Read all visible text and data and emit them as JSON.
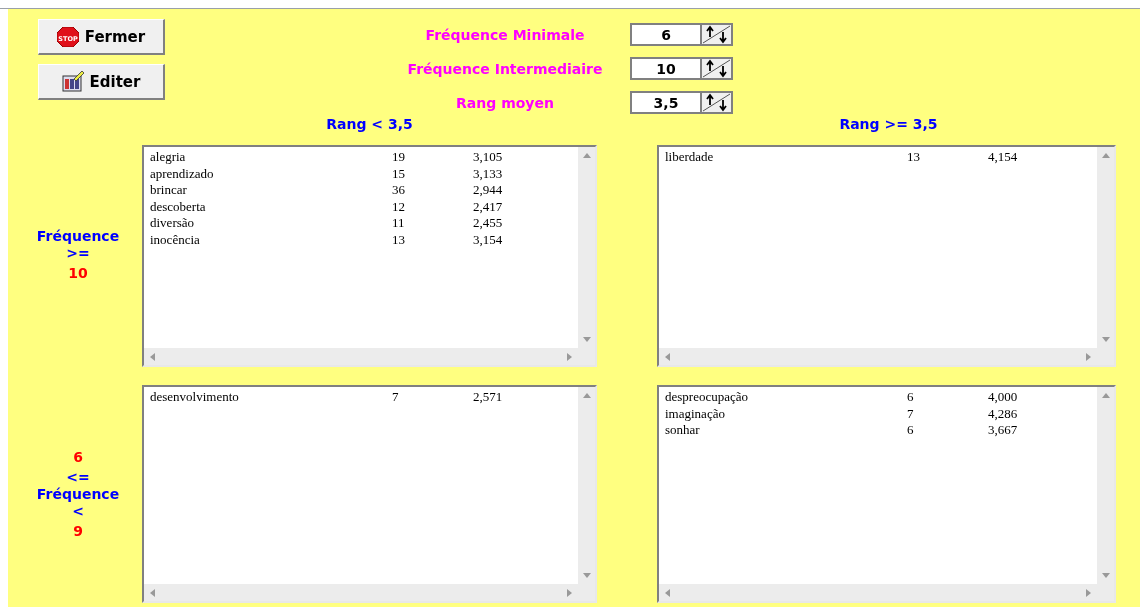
{
  "buttons": [
    {
      "kind": "stop",
      "label": "Fermer",
      "icon_label": "STOP"
    },
    {
      "kind": "edit",
      "label": "Editer"
    }
  ],
  "spinners": [
    {
      "label": "Fréquence Minimale",
      "value": "6"
    },
    {
      "label": "Fréquence Intermediaire",
      "value": "10"
    },
    {
      "label": "Rang moyen",
      "value": "3,5"
    }
  ],
  "column_headers": [
    "Rang < 3,5",
    "Rang >= 3,5"
  ],
  "row_groups": [
    {
      "label_lines": [
        {
          "kind": "text",
          "text": "Fréquence"
        },
        {
          "kind": "text",
          "text": ">="
        },
        {
          "kind": "value",
          "text": "10"
        }
      ],
      "lists": [
        {
          "rows": [
            [
              "alegria",
              "19",
              "3,105"
            ],
            [
              "aprendizado",
              "15",
              "3,133"
            ],
            [
              "brincar",
              "36",
              "2,944"
            ],
            [
              "descoberta",
              "12",
              "2,417"
            ],
            [
              "diversão",
              "11",
              "2,455"
            ],
            [
              "inocência",
              "13",
              "3,154"
            ]
          ]
        },
        {
          "rows": [
            [
              "liberdade",
              "13",
              "4,154"
            ]
          ]
        }
      ]
    },
    {
      "label_lines": [
        {
          "kind": "value",
          "text": "6"
        },
        {
          "kind": "text",
          "text": "<="
        },
        {
          "kind": "text",
          "text": "Fréquence"
        },
        {
          "kind": "text",
          "text": "<"
        },
        {
          "kind": "value",
          "text": "9"
        }
      ],
      "lists": [
        {
          "rows": [
            [
              "desenvolvimento",
              "7",
              "2,571"
            ]
          ]
        },
        {
          "rows": [
            [
              "despreocupação",
              "6",
              "4,000"
            ],
            [
              "imaginação",
              "7",
              "4,286"
            ],
            [
              "sonhar",
              "6",
              "3,667"
            ]
          ]
        }
      ]
    }
  ]
}
